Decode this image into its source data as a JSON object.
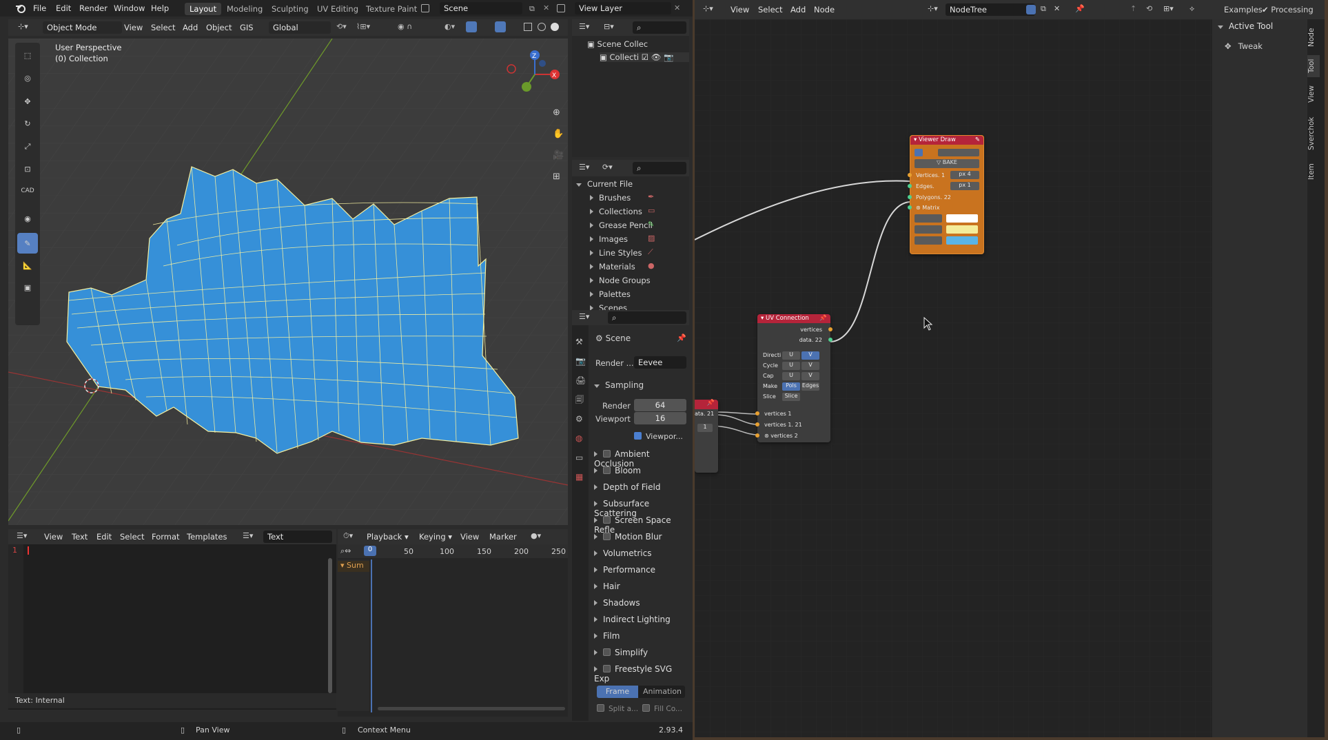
{
  "topbar": {
    "menus": [
      "File",
      "Edit",
      "Render",
      "Window",
      "Help"
    ],
    "workspaces": [
      "Layout",
      "Modeling",
      "Sculpting",
      "UV Editing",
      "Texture Paint"
    ],
    "scene": "Scene",
    "view_layer": "View Layer"
  },
  "viewport": {
    "mode": "Object Mode",
    "menus": [
      "View",
      "Select",
      "Add",
      "Object",
      "GIS"
    ],
    "transform": "Global",
    "perspective": "User Perspective",
    "collection": "(0) Collection",
    "cad_label": "CAD",
    "mesh_color": "#3690d8",
    "wire_color": "#f5f0a0"
  },
  "outliner": {
    "scene_collection": "Scene Collec",
    "collection": "Collecti"
  },
  "blend_file": {
    "current_file": "Current File",
    "items": [
      "Brushes",
      "Collections",
      "Grease Pencil",
      "Images",
      "Line Styles",
      "Materials",
      "Node Groups",
      "Palettes",
      "Scenes"
    ]
  },
  "properties": {
    "scene": "Scene",
    "render_engine_label": "Render ...",
    "render_engine": "Eevee",
    "sampling": "Sampling",
    "render_label": "Render",
    "render_value": "64",
    "viewport_label": "Viewport",
    "viewport_value": "16",
    "viewport_denoise": "Viewpor...",
    "sections": [
      {
        "label": "Ambient Occlusion",
        "checkbox": true
      },
      {
        "label": "Bloom",
        "checkbox": true
      },
      {
        "label": "Depth of Field",
        "checkbox": false
      },
      {
        "label": "Subsurface Scattering",
        "checkbox": false
      },
      {
        "label": "Screen Space Refle",
        "checkbox": true
      },
      {
        "label": "Motion Blur",
        "checkbox": true
      },
      {
        "label": "Volumetrics",
        "checkbox": false
      },
      {
        "label": "Performance",
        "checkbox": false
      },
      {
        "label": "Hair",
        "checkbox": false
      },
      {
        "label": "Shadows",
        "checkbox": false
      },
      {
        "label": "Indirect Lighting",
        "checkbox": false
      },
      {
        "label": "Film",
        "checkbox": false
      },
      {
        "label": "Simplify",
        "checkbox": true
      },
      {
        "label": "Freestyle SVG Exp",
        "checkbox": true
      }
    ],
    "frame_btn": "Frame",
    "animation_btn": "Animation",
    "split_label": "Split a...",
    "fill_label": "Fill Co..."
  },
  "text_editor": {
    "menus": [
      "View",
      "Text",
      "Edit",
      "Select",
      "Format",
      "Templates"
    ],
    "text_name": "Text",
    "line_number": "1",
    "footer": "Text: Internal"
  },
  "timeline": {
    "playback": "Playback",
    "keying": "Keying",
    "view": "View",
    "marker": "Marker",
    "current_frame": "0",
    "ticks": [
      "50",
      "100",
      "150",
      "200",
      "250"
    ],
    "summary": "Sum"
  },
  "statusbar": {
    "pan": "Pan View",
    "context": "Context Menu",
    "version": "2.93.4"
  },
  "node_editor": {
    "menus": [
      "View",
      "Select",
      "Add",
      "Node"
    ],
    "tree": "NodeTree",
    "examples": "Examples",
    "processing": "Processing",
    "active_tool": "Active Tool",
    "tweak": "Tweak",
    "tabs": [
      "Node",
      "Tool",
      "View",
      "Sverchok",
      "Item"
    ]
  },
  "viewer_draw": {
    "title": "Viewer Draw",
    "bake": "BAKE",
    "vertices": "Vertices. 1",
    "vertices_px": "px  4",
    "edges": "Edges.",
    "edges_px": "px  1",
    "polygons": "Polygons. 22",
    "matrix": "Matrix",
    "colors": [
      "#ffffff",
      "#f4ec9a",
      "#5ab4e6"
    ],
    "header_color": "#c9731f"
  },
  "uv_connection": {
    "title": "UV Connection",
    "out_vertices": "vertices",
    "out_data": "data. 22",
    "rows": [
      {
        "label": "Directi",
        "a": "U",
        "b": "V",
        "active": "b"
      },
      {
        "label": "Cycle",
        "a": "U",
        "b": "V",
        "active": ""
      },
      {
        "label": "Cap",
        "a": "U",
        "b": "V",
        "active": ""
      },
      {
        "label": "Make",
        "a": "Pols",
        "b": "Edges",
        "active": "a"
      },
      {
        "label": "Slice",
        "a": "Slice",
        "b": "",
        "active": ""
      }
    ],
    "inputs": [
      "vertices 1",
      "vertices 1. 21",
      "vertices 2"
    ],
    "header_color": "#b5243a"
  },
  "partial_node": {
    "label": "ata. 21",
    "value": "1"
  }
}
